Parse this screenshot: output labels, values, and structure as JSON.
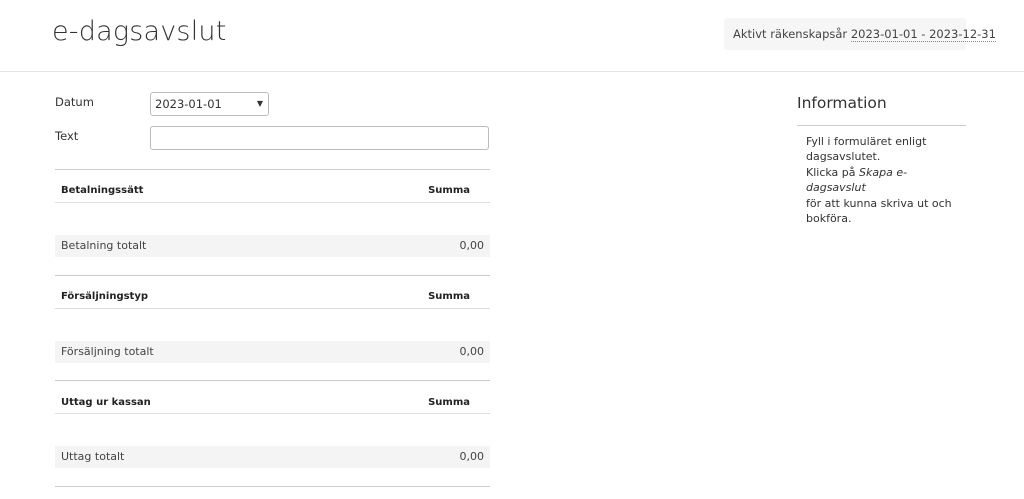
{
  "header": {
    "title": "e-dagsavslut",
    "fiscal_year_label": "Aktivt räkenskapsår",
    "fiscal_year_value": "2023-01-01 - 2023-12-31"
  },
  "form": {
    "date_label": "Datum",
    "date_value": "2023-01-01",
    "text_label": "Text",
    "text_value": "",
    "text_placeholder": ""
  },
  "sections": {
    "payments": {
      "col_label": "Betalningssätt",
      "col_amount": "Summa",
      "total_label": "Betalning totalt",
      "total_value": "0,00"
    },
    "sales": {
      "col_label": "Försäljningstyp",
      "col_amount": "Summa",
      "total_label": "Försäljning totalt",
      "total_value": "0,00"
    },
    "withdrawals": {
      "col_label": "Uttag ur kassan",
      "col_amount": "Summa",
      "total_label": "Uttag totalt",
      "total_value": "0,00"
    }
  },
  "info": {
    "title": "Information",
    "line1": "Fyll i formuläret enligt dagsavslutet.",
    "line2_prefix": "Klicka på ",
    "line2_emphasis": "Skapa e-dagsavslut",
    "line2_suffix": "för att kunna skriva ut och bokföra."
  },
  "icons": {
    "dropdown": "chevron-down-icon"
  }
}
